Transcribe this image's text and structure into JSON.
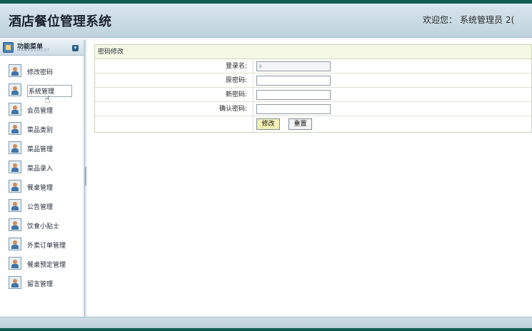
{
  "header": {
    "title": "酒店餐位管理系统",
    "welcome_label": "欢迎您：",
    "user_name": "系统管理员",
    "date_fragment": "2("
  },
  "sidebar": {
    "menu_title": "功能菜单",
    "menu_subtitle": "MANAGEMENT",
    "toggle_icon": "▾",
    "items": [
      {
        "label": "修改密码"
      },
      {
        "label": "系统管理"
      },
      {
        "label": "会员管理"
      },
      {
        "label": "菜品类别"
      },
      {
        "label": "菜品管理"
      },
      {
        "label": "菜品录入"
      },
      {
        "label": "餐桌管理"
      },
      {
        "label": "公告管理"
      },
      {
        "label": "饮食小贴士"
      },
      {
        "label": "外卖订单管理"
      },
      {
        "label": "餐桌预定管理"
      },
      {
        "label": "留言管理"
      }
    ],
    "active_item": "系统管理"
  },
  "form": {
    "title": "密码修改",
    "username_label": "登录名:",
    "username_value": "a",
    "old_password_label": "原密码:",
    "old_password_value": "",
    "new_password_label": "新密码:",
    "new_password_value": "",
    "confirm_password_label": "确认密码:",
    "confirm_password_value": "",
    "submit_label": "修改",
    "reset_label": "重置"
  },
  "colors": {
    "header_bg": "#c8dae3",
    "accent_dark": "#0f5d52",
    "panel_title_bg": "#f6f8e6",
    "submit_bg": "#f3f1b4"
  }
}
